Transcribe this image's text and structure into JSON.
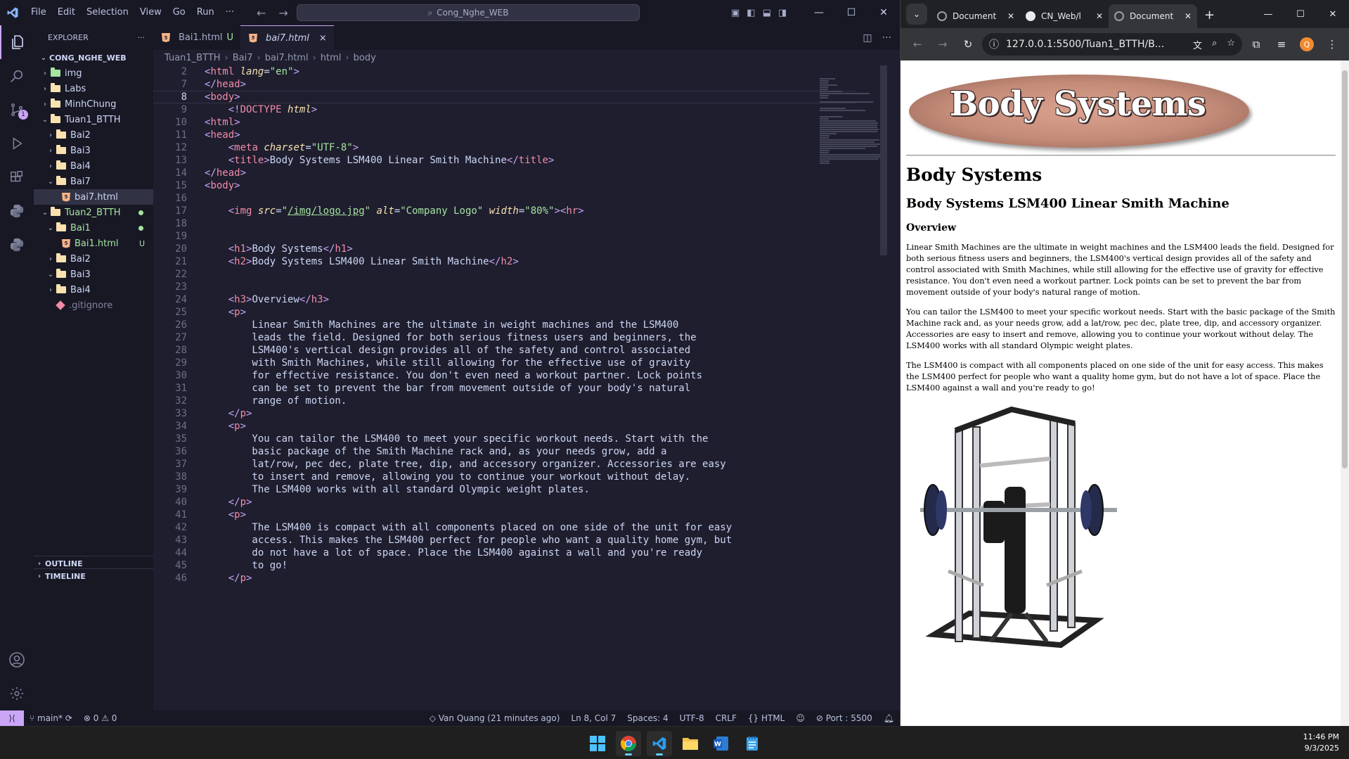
{
  "vscode": {
    "menu": [
      "File",
      "Edit",
      "Selection",
      "View",
      "Go",
      "Run",
      "···"
    ],
    "search": "Cong_Nghe_WEB",
    "explorer": {
      "header": "EXPLORER",
      "root": "CONG_NGHE_WEB",
      "items": [
        {
          "label": "img",
          "indent": 0,
          "type": "folder-img",
          "open": false
        },
        {
          "label": "Labs",
          "indent": 0,
          "type": "folder",
          "open": false
        },
        {
          "label": "MinhChung",
          "indent": 0,
          "type": "folder",
          "open": false
        },
        {
          "label": "Tuan1_BTTH",
          "indent": 0,
          "type": "folder",
          "open": true
        },
        {
          "label": "Bai2",
          "indent": 1,
          "type": "folder",
          "open": false
        },
        {
          "label": "Bai3",
          "indent": 1,
          "type": "folder",
          "open": false
        },
        {
          "label": "Bai4",
          "indent": 1,
          "type": "folder",
          "open": false
        },
        {
          "label": "Bai7",
          "indent": 1,
          "type": "folder",
          "open": true
        },
        {
          "label": "bai7.html",
          "indent": 2,
          "type": "html",
          "selected": true
        },
        {
          "label": "Tuan2_BTTH",
          "indent": 0,
          "type": "folder",
          "open": true,
          "git": "dot"
        },
        {
          "label": "Bai1",
          "indent": 1,
          "type": "folder",
          "open": true,
          "git": "dot"
        },
        {
          "label": "Bai1.html",
          "indent": 2,
          "type": "html",
          "git": "U"
        },
        {
          "label": "Bai2",
          "indent": 1,
          "type": "folder",
          "open": false
        },
        {
          "label": "Bai3",
          "indent": 1,
          "type": "folder",
          "open": true
        },
        {
          "label": "Bai4",
          "indent": 1,
          "type": "folder",
          "open": false
        },
        {
          "label": ".gitignore",
          "indent": 1,
          "type": "git"
        }
      ],
      "outline": "OUTLINE",
      "timeline": "TIMELINE"
    },
    "tabs": [
      {
        "label": "Bai1.html",
        "status": "U"
      },
      {
        "label": "bai7.html",
        "status": "×"
      }
    ],
    "breadcrumb": [
      "Tuan1_BTTH",
      "Bai7",
      "bai7.html",
      "html",
      "body"
    ],
    "code": [
      {
        "n": 2,
        "html": "<span class='t'>&lt;</span><span class='tg'>html</span> <span class='at'>lang</span>=<span class='st'>\"en\"</span><span class='t'>&gt;</span>"
      },
      {
        "n": 7,
        "html": "<span class='t'>&lt;/</span><span class='tg'>head</span><span class='t'>&gt;</span>"
      },
      {
        "n": 8,
        "html": "<span class='t'>&lt;</span><span class='tg'>body</span><span class='t'>&gt;</span>",
        "cur": true
      },
      {
        "n": 9,
        "html": "    <span class='t'>&lt;!</span><span class='tg'>DOCTYPE</span> <span class='at'>html</span><span class='t'>&gt;</span>"
      },
      {
        "n": 10,
        "html": "<span class='t'>&lt;</span><span class='tg'>html</span><span class='t'>&gt;</span>"
      },
      {
        "n": 11,
        "html": "<span class='t'>&lt;</span><span class='tg'>head</span><span class='t'>&gt;</span>"
      },
      {
        "n": 12,
        "html": "    <span class='t'>&lt;</span><span class='tg'>meta</span> <span class='at'>charset</span>=<span class='st'>\"UTF-8\"</span><span class='t'>&gt;</span>"
      },
      {
        "n": 13,
        "html": "    <span class='t'>&lt;</span><span class='tg'>title</span><span class='t'>&gt;</span>Body Systems LSM400 Linear Smith Machine<span class='t'>&lt;/</span><span class='tg'>title</span><span class='t'>&gt;</span>"
      },
      {
        "n": 14,
        "html": "<span class='t'>&lt;/</span><span class='tg'>head</span><span class='t'>&gt;</span>"
      },
      {
        "n": 15,
        "html": "<span class='t'>&lt;</span><span class='tg'>body</span><span class='t'>&gt;</span>"
      },
      {
        "n": 16,
        "html": ""
      },
      {
        "n": 17,
        "html": "    <span class='t'>&lt;</span><span class='tg'>img</span> <span class='at'>src</span>=<span class='st'>\"<u>/img/logo.jpg</u>\"</span> <span class='at'>alt</span>=<span class='st'>\"Company Logo\"</span> <span class='at'>width</span>=<span class='st'>\"80%\"</span><span class='t'>&gt;&lt;</span><span class='tg'>hr</span><span class='t'>&gt;</span>"
      },
      {
        "n": 18,
        "html": ""
      },
      {
        "n": 19,
        "html": ""
      },
      {
        "n": 20,
        "html": "    <span class='t'>&lt;</span><span class='tg'>h1</span><span class='t'>&gt;</span>Body Systems<span class='t'>&lt;/</span><span class='tg'>h1</span><span class='t'>&gt;</span>"
      },
      {
        "n": 21,
        "html": "    <span class='t'>&lt;</span><span class='tg'>h2</span><span class='t'>&gt;</span>Body Systems LSM400 Linear Smith Machine<span class='t'>&lt;/</span><span class='tg'>h2</span><span class='t'>&gt;</span>"
      },
      {
        "n": 22,
        "html": ""
      },
      {
        "n": 23,
        "html": ""
      },
      {
        "n": 24,
        "html": "    <span class='t'>&lt;</span><span class='tg'>h3</span><span class='t'>&gt;</span>Overview<span class='t'>&lt;/</span><span class='tg'>h3</span><span class='t'>&gt;</span>"
      },
      {
        "n": 25,
        "html": "    <span class='t'>&lt;</span><span class='tg'>p</span><span class='t'>&gt;</span>"
      },
      {
        "n": 26,
        "html": "        Linear Smith Machines are the ultimate in weight machines and the LSM400"
      },
      {
        "n": 27,
        "html": "        leads the field. Designed for both serious fitness users and beginners, the"
      },
      {
        "n": 28,
        "html": "        LSM400's vertical design provides all of the safety and control associated"
      },
      {
        "n": 29,
        "html": "        with Smith Machines, while still allowing for the effective use of gravity"
      },
      {
        "n": 30,
        "html": "        for effective resistance. You don't even need a workout partner. Lock points"
      },
      {
        "n": 31,
        "html": "        can be set to prevent the bar from movement outside of your body's natural"
      },
      {
        "n": 32,
        "html": "        range of motion."
      },
      {
        "n": 33,
        "html": "    <span class='t'>&lt;/</span><span class='tg'>p</span><span class='t'>&gt;</span>"
      },
      {
        "n": 34,
        "html": "    <span class='t'>&lt;</span><span class='tg'>p</span><span class='t'>&gt;</span>"
      },
      {
        "n": 35,
        "html": "        You can tailor the LSM400 to meet your specific workout needs. Start with the"
      },
      {
        "n": 36,
        "html": "        basic package of the Smith Machine rack and, as your needs grow, add a"
      },
      {
        "n": 37,
        "html": "        lat/row, pec dec, plate tree, dip, and accessory organizer. Accessories are easy"
      },
      {
        "n": 38,
        "html": "        to insert and remove, allowing you to continue your workout without delay."
      },
      {
        "n": 39,
        "html": "        The LSM400 works with all standard Olympic weight plates."
      },
      {
        "n": 40,
        "html": "    <span class='t'>&lt;/</span><span class='tg'>p</span><span class='t'>&gt;</span>"
      },
      {
        "n": 41,
        "html": "    <span class='t'>&lt;</span><span class='tg'>p</span><span class='t'>&gt;</span>"
      },
      {
        "n": 42,
        "html": "        The LSM400 is compact with all components placed on one side of the unit for easy"
      },
      {
        "n": 43,
        "html": "        access. This makes the LSM400 perfect for people who want a quality home gym, but"
      },
      {
        "n": 44,
        "html": "        do not have a lot of space. Place the LSM400 against a wall and you're ready"
      },
      {
        "n": 45,
        "html": "        to go!"
      },
      {
        "n": 46,
        "html": "    <span class='t'>&lt;/</span><span class='tg'>p</span><span class='t'>&gt;</span>"
      }
    ],
    "status": {
      "branch": "main*",
      "problems": "⊗ 0 ⚠ 0",
      "blame": "Van Quang (21 minutes ago)",
      "position": "Ln 8, Col 7",
      "spaces": "Spaces: 4",
      "encoding": "UTF-8",
      "eol": "CRLF",
      "language": "{} HTML",
      "port": "⊘ Port : 5500"
    }
  },
  "chrome": {
    "tabs": [
      {
        "label": "Document",
        "icon": "globe"
      },
      {
        "label": "CN_Web/l",
        "icon": "github"
      },
      {
        "label": "Document",
        "icon": "globe",
        "active": true
      }
    ],
    "url": "127.0.0.1:5500/Tuan1_BTTH/B...",
    "avatar": "Q",
    "page": {
      "logo_text": "Body Systems",
      "h1": "Body Systems",
      "h2": "Body Systems LSM400 Linear Smith Machine",
      "h3": "Overview",
      "p1": "Linear Smith Machines are the ultimate in weight machines and the LSM400 leads the field. Designed for both serious fitness users and beginners, the LSM400's vertical design provides all of the safety and control associated with Smith Machines, while still allowing for the effective use of gravity for effective resistance. You don't even need a workout partner. Lock points can be set to prevent the bar from movement outside of your body's natural range of motion.",
      "p2": "You can tailor the LSM400 to meet your specific workout needs. Start with the basic package of the Smith Machine rack and, as your needs grow, add a lat/row, pec dec, plate tree, dip, and accessory organizer. Accessories are easy to insert and remove, allowing you to continue your workout without delay. The LSM400 works with all standard Olympic weight plates.",
      "p3": "The LSM400 is compact with all components placed on one side of the unit for easy access. This makes the LSM400 perfect for people who want a quality home gym, but do not have a lot of space. Place the LSM400 against a wall and you're ready to go!"
    }
  },
  "taskbar": {
    "time": "11:46 PM",
    "date": "9/3/2025"
  }
}
